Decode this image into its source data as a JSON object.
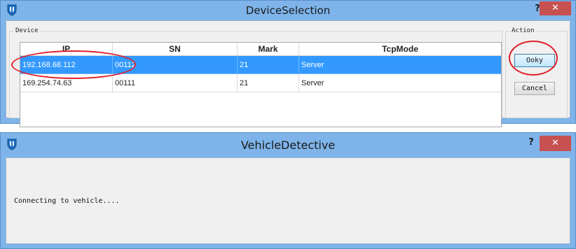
{
  "device_selection": {
    "title": "DeviceSelection",
    "help_label": "?",
    "close_label": "✕",
    "device_group_label": "Device",
    "action_group_label": "Action",
    "columns": [
      "IP",
      "SN",
      "Mark",
      "TcpMode"
    ],
    "rows": [
      {
        "ip": "192.168.68.112",
        "sn": "00112",
        "mark": "21",
        "tcp_mode": "Server",
        "selected": true
      },
      {
        "ip": "169.254.74.63",
        "sn": "00111",
        "mark": "21",
        "tcp_mode": "Server",
        "selected": false
      }
    ],
    "ok_label": "Ooky",
    "cancel_label": "Cancel"
  },
  "vehicle_detective": {
    "title": "VehicleDetective",
    "help_label": "?",
    "close_label": "✕",
    "status_text": "Connecting to vehicle...."
  },
  "colors": {
    "title_bar": "#7eb4ea",
    "selection": "#3399ff",
    "annotation": "#e0202a",
    "close_button": "#c75050"
  }
}
